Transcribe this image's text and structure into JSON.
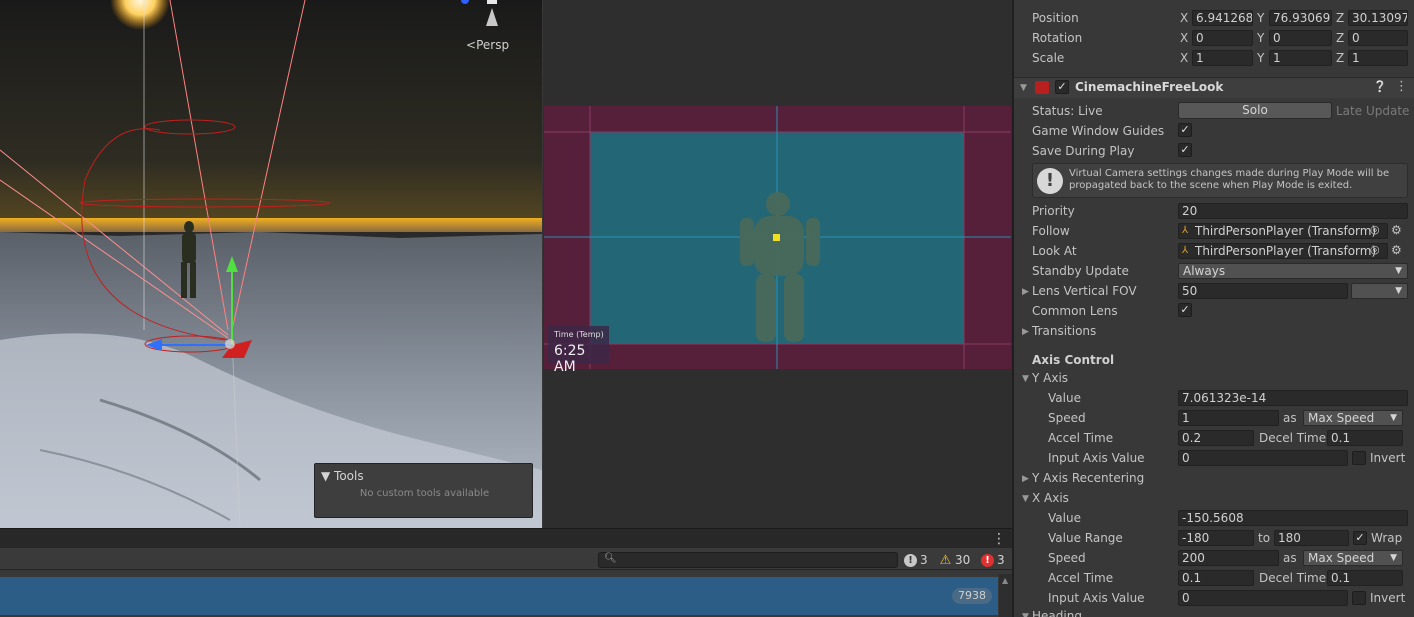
{
  "scene": {
    "persp_label": "Persp",
    "tools_title": "Tools",
    "tools_message": "No custom tools available"
  },
  "game": {
    "time_label": "Time (Temp)",
    "time_value": "6:25 AM"
  },
  "console": {
    "badges": [
      {
        "icon": "info-icon",
        "count": "3"
      },
      {
        "icon": "warning-icon",
        "count": "30"
      },
      {
        "icon": "error-icon",
        "count": "3"
      }
    ],
    "row_count": "7938"
  },
  "inspector": {
    "transform": {
      "position": {
        "label": "Position",
        "x": "6.941268",
        "y": "76.93069",
        "z": "30.13097"
      },
      "rotation": {
        "label": "Rotation",
        "x": "0",
        "y": "0",
        "z": "0"
      },
      "scale": {
        "label": "Scale",
        "x": "1",
        "y": "1",
        "z": "1"
      },
      "axis_x": "X",
      "axis_y": "Y",
      "axis_z": "Z"
    },
    "component": {
      "title": "CinemachineFreeLook",
      "enabled": true
    },
    "status": {
      "label": "Status: Live",
      "solo": "Solo",
      "late_update": "Late Update"
    },
    "game_window_guides": {
      "label": "Game Window Guides",
      "checked": true
    },
    "save_during_play": {
      "label": "Save During Play",
      "checked": true
    },
    "help_box": "Virtual Camera settings changes made during Play Mode will be propagated back to the scene when Play Mode is exited.",
    "priority": {
      "label": "Priority",
      "value": "20"
    },
    "follow": {
      "label": "Follow",
      "value": "ThirdPersonPlayer (Transform)"
    },
    "look_at": {
      "label": "Look At",
      "value": "ThirdPersonPlayer (Transform)"
    },
    "standby_update": {
      "label": "Standby Update",
      "value": "Always"
    },
    "lens_fov": {
      "label": "Lens Vertical FOV",
      "value": "50"
    },
    "common_lens": {
      "label": "Common Lens",
      "checked": true
    },
    "transitions": {
      "label": "Transitions"
    },
    "axis_control": "Axis Control",
    "y_axis": {
      "label": "Y Axis",
      "value_label": "Value",
      "value": "7.061323e-14",
      "speed_label": "Speed",
      "speed": "1",
      "as_label": "as",
      "speed_mode": "Max Speed",
      "accel_label": "Accel Time",
      "accel": "0.2",
      "decel_label": "Decel Time",
      "decel": "0.1",
      "input_label": "Input Axis Value",
      "input": "0",
      "invert_label": "Invert"
    },
    "y_recentering": {
      "label": "Y Axis Recentering"
    },
    "x_axis": {
      "label": "X Axis",
      "value_label": "Value",
      "value": "-150.5608",
      "range_label": "Value Range",
      "range_min": "-180",
      "to_label": "to",
      "range_max": "180",
      "wrap_label": "Wrap",
      "speed_label": "Speed",
      "speed": "200",
      "as_label": "as",
      "speed_mode": "Max Speed",
      "accel_label": "Accel Time",
      "accel": "0.1",
      "decel_label": "Decel Time",
      "decel": "0.1",
      "input_label": "Input Axis Value",
      "input": "0",
      "invert_label": "Invert"
    },
    "heading": {
      "label": "Heading"
    }
  }
}
